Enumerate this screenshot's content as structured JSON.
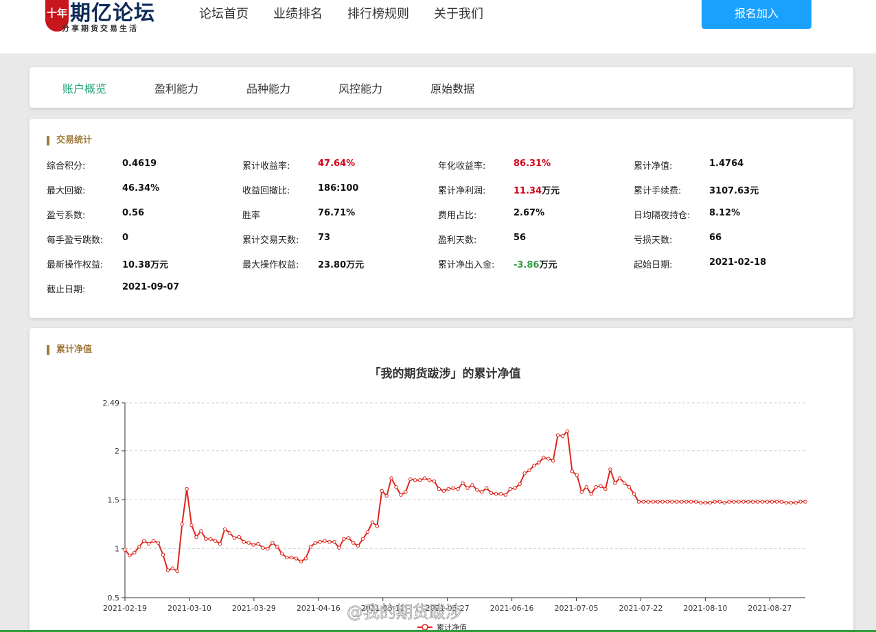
{
  "header": {
    "logo_seal": "十年",
    "logo_name": "期亿论坛",
    "logo_tagline": "分享期货交易生活",
    "nav": [
      "论坛首页",
      "业绩排名",
      "排行榜规则",
      "关于我们"
    ],
    "join_button": "报名加入"
  },
  "tabs": [
    "账户概览",
    "盈利能力",
    "品种能力",
    "风控能力",
    "原始数据"
  ],
  "active_tab": 0,
  "stats": {
    "title": "交易统计",
    "items": [
      {
        "label": "综合积分:",
        "value": "0.4619",
        "unit": "",
        "color": "default"
      },
      {
        "label": "累计收益率:",
        "value": "47.64%",
        "unit": "",
        "color": "red"
      },
      {
        "label": "年化收益率:",
        "value": "86.31%",
        "unit": "",
        "color": "red"
      },
      {
        "label": "累计净值:",
        "value": "1.4764",
        "unit": "",
        "color": "default"
      },
      {
        "label": "最大回撤:",
        "value": "46.34%",
        "unit": "",
        "color": "default"
      },
      {
        "label": "收益回撤比:",
        "value": "186:100",
        "unit": "",
        "color": "default"
      },
      {
        "label": "累计净利润:",
        "value": "11.34",
        "unit": "万元",
        "color": "red"
      },
      {
        "label": "累计手续费:",
        "value": "3107.63元",
        "unit": "",
        "color": "default"
      },
      {
        "label": "盈亏系数:",
        "value": "0.56",
        "unit": "",
        "color": "default"
      },
      {
        "label": "胜率",
        "value": "76.71%",
        "unit": "",
        "color": "default"
      },
      {
        "label": "费用占比:",
        "value": "2.67%",
        "unit": "",
        "color": "default"
      },
      {
        "label": "日均隔夜持仓:",
        "value": "8.12%",
        "unit": "",
        "color": "default"
      },
      {
        "label": "每手盈亏跳数:",
        "value": "0",
        "unit": "",
        "color": "default"
      },
      {
        "label": "累计交易天数:",
        "value": "73",
        "unit": "",
        "color": "default"
      },
      {
        "label": "盈利天数:",
        "value": "56",
        "unit": "",
        "color": "default"
      },
      {
        "label": "亏损天数:",
        "value": "66",
        "unit": "",
        "color": "default"
      },
      {
        "label": "最新操作权益:",
        "value": "10.38万元",
        "unit": "",
        "color": "default"
      },
      {
        "label": "最大操作权益:",
        "value": "23.80万元",
        "unit": "",
        "color": "default"
      },
      {
        "label": "累计净出入金:",
        "value": "-3.86",
        "unit": "万元",
        "color": "green"
      },
      {
        "label": "起始日期:",
        "value": "2021-02-18",
        "unit": "",
        "color": "default"
      },
      {
        "label": "截止日期:",
        "value": "2021-09-07",
        "unit": "",
        "color": "default"
      }
    ]
  },
  "chart_section_title": "累计净值",
  "watermark": "@我的期货跋涉",
  "colors": {
    "accent": "#1aa0ff",
    "active_tab": "#1aa378",
    "section": "#a07a3a",
    "line": "#e0251b",
    "positive": "#d0021b",
    "negative": "#2e9d3c"
  },
  "chart_data": {
    "type": "line",
    "title": "「我的期货跋涉」的累计净值",
    "ylim": [
      0.5,
      2.49
    ],
    "yticks": [
      0.5,
      1,
      1.5,
      2,
      2.49
    ],
    "ytick_labels": [
      "0.5",
      "1",
      "1.5",
      "2",
      "2.49"
    ],
    "xtick_labels": [
      "2021-02-19",
      "2021-03-10",
      "2021-03-29",
      "2021-04-16",
      "2021-05-11",
      "2021-05-27",
      "2021-06-16",
      "2021-07-05",
      "2021-07-22",
      "2021-08-10",
      "2021-08-27"
    ],
    "grid": true,
    "legend_position": "bottom",
    "series": [
      {
        "name": "累计净值",
        "values": [
          0.99,
          0.93,
          0.96,
          1.02,
          1.08,
          1.05,
          1.08,
          1.06,
          0.94,
          0.78,
          0.8,
          0.77,
          1.25,
          1.61,
          1.24,
          1.12,
          1.18,
          1.1,
          1.1,
          1.08,
          1.05,
          1.2,
          1.16,
          1.11,
          1.12,
          1.07,
          1.06,
          1.04,
          1.05,
          1.01,
          1.0,
          1.06,
          1.02,
          0.95,
          0.91,
          0.91,
          0.9,
          0.87,
          0.9,
          1.02,
          1.06,
          1.07,
          1.08,
          1.07,
          1.07,
          1.01,
          1.1,
          1.11,
          1.06,
          1.03,
          1.1,
          1.17,
          1.27,
          1.23,
          1.59,
          1.54,
          1.72,
          1.63,
          1.55,
          1.58,
          1.71,
          1.7,
          1.7,
          1.72,
          1.7,
          1.69,
          1.61,
          1.59,
          1.61,
          1.62,
          1.61,
          1.67,
          1.62,
          1.65,
          1.6,
          1.58,
          1.62,
          1.57,
          1.56,
          1.56,
          1.55,
          1.61,
          1.62,
          1.66,
          1.77,
          1.8,
          1.85,
          1.88,
          1.93,
          1.92,
          1.9,
          2.16,
          2.15,
          2.2,
          1.79,
          1.75,
          1.58,
          1.63,
          1.56,
          1.63,
          1.64,
          1.61,
          1.81,
          1.67,
          1.72,
          1.67,
          1.63,
          1.56,
          1.48,
          1.48,
          1.48,
          1.48,
          1.48,
          1.48,
          1.48,
          1.48,
          1.48,
          1.48,
          1.48,
          1.48,
          1.48,
          1.47,
          1.47,
          1.47,
          1.48,
          1.48,
          1.47,
          1.48,
          1.48,
          1.48,
          1.48,
          1.48,
          1.48,
          1.48,
          1.48,
          1.48,
          1.48,
          1.48,
          1.48,
          1.47,
          1.47,
          1.47,
          1.48,
          1.48
        ]
      }
    ]
  }
}
